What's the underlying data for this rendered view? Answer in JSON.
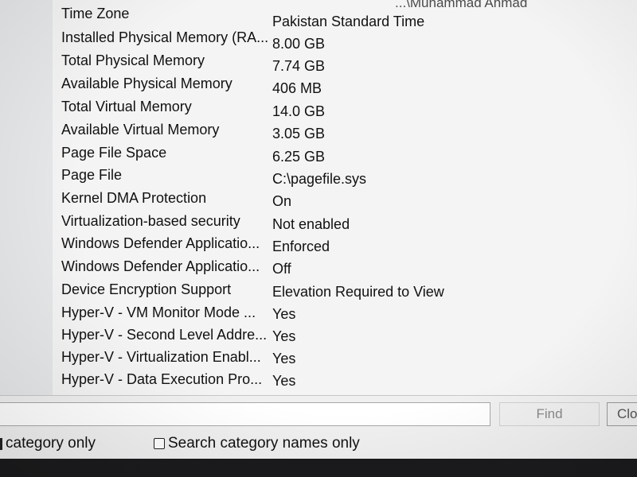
{
  "header": {
    "visible_fragment": "...\\Muhammad Ahmad"
  },
  "rows": [
    {
      "item": "Time Zone",
      "value": "Pakistan Standard Time"
    },
    {
      "item": "Installed Physical Memory (RA...",
      "value": "8.00 GB"
    },
    {
      "item": "Total Physical Memory",
      "value": "7.74 GB"
    },
    {
      "item": "Available Physical Memory",
      "value": "406 MB"
    },
    {
      "item": "Total Virtual Memory",
      "value": "14.0 GB"
    },
    {
      "item": "Available Virtual Memory",
      "value": "3.05 GB"
    },
    {
      "item": "Page File Space",
      "value": "6.25 GB"
    },
    {
      "item": "Page File",
      "value": "C:\\pagefile.sys"
    },
    {
      "item": "Kernel DMA Protection",
      "value": "On"
    },
    {
      "item": "Virtualization-based security",
      "value": "Not enabled"
    },
    {
      "item": "Windows Defender Applicatio...",
      "value": "Enforced"
    },
    {
      "item": "Windows Defender Applicatio...",
      "value": "Off"
    },
    {
      "item": "Device Encryption Support",
      "value": "Elevation Required to View"
    },
    {
      "item": "Hyper-V - VM Monitor Mode ...",
      "value": "Yes"
    },
    {
      "item": "Hyper-V - Second Level Addre...",
      "value": "Yes"
    },
    {
      "item": "Hyper-V - Virtualization Enabl...",
      "value": "Yes"
    },
    {
      "item": "Hyper-V - Data Execution Pro...",
      "value": "Yes"
    }
  ],
  "find_bar": {
    "input_value": "",
    "find_label": "Find",
    "close_label": "Clo",
    "option_selected_label": "category only",
    "option_names_label": "Search category names only"
  }
}
